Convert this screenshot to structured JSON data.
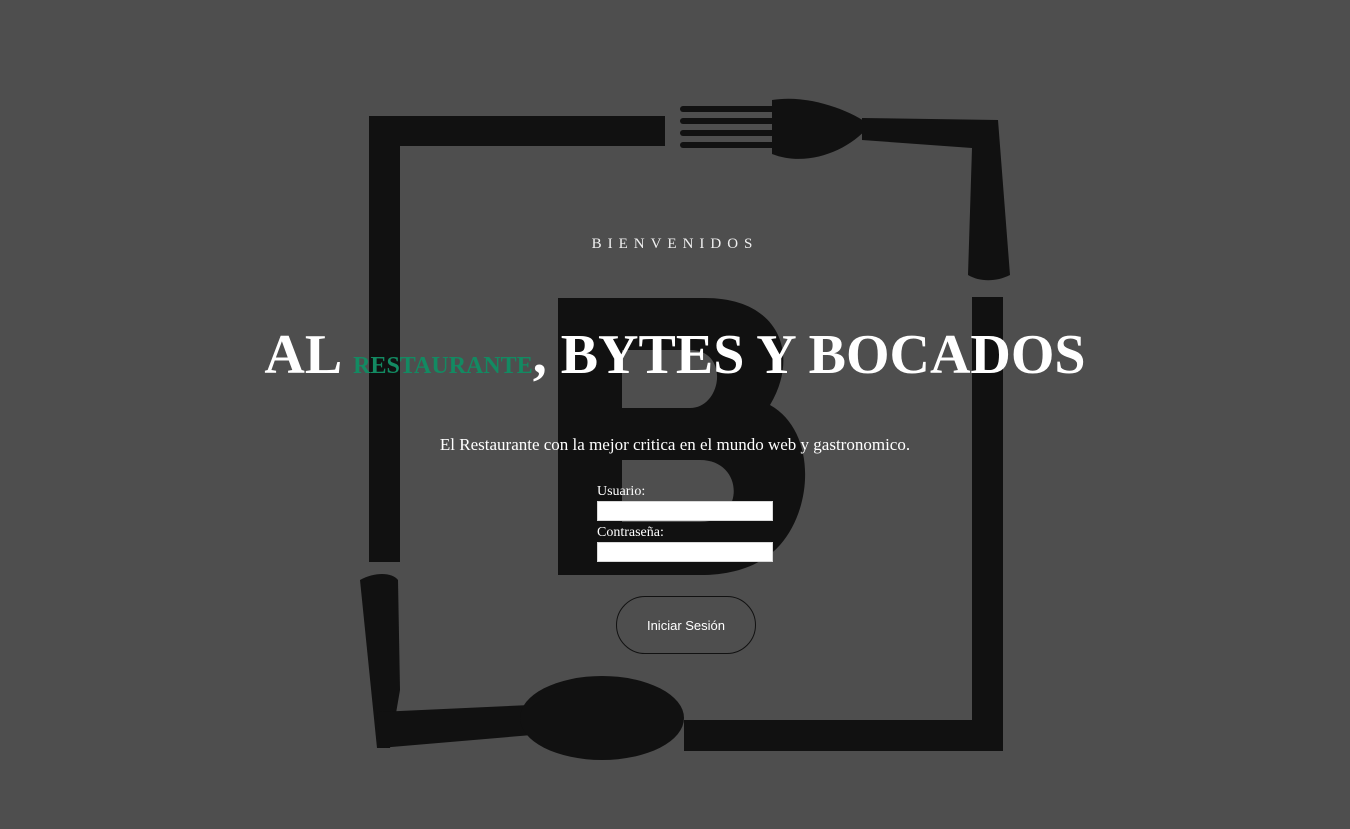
{
  "hero": {
    "welcome": "BIENVENIDOS",
    "headline_part1": "AL ",
    "headline_accent": "RESTAURANTE",
    "headline_part2": ", BYTES Y BOCADOS",
    "tagline": "El Restaurante con la mejor critica en el mundo web y gastronomico."
  },
  "login": {
    "username_label": "Usuario:",
    "username_value": "",
    "password_label": "Contraseña:",
    "password_value": "",
    "submit_label": "Iniciar Sesión"
  },
  "logo": {
    "letter": "B",
    "icon": "fork-spoon-frame-logo"
  },
  "colors": {
    "background": "#4e4e4e",
    "logo": "#111111",
    "accent": "#138a62",
    "text": "#ffffff"
  }
}
